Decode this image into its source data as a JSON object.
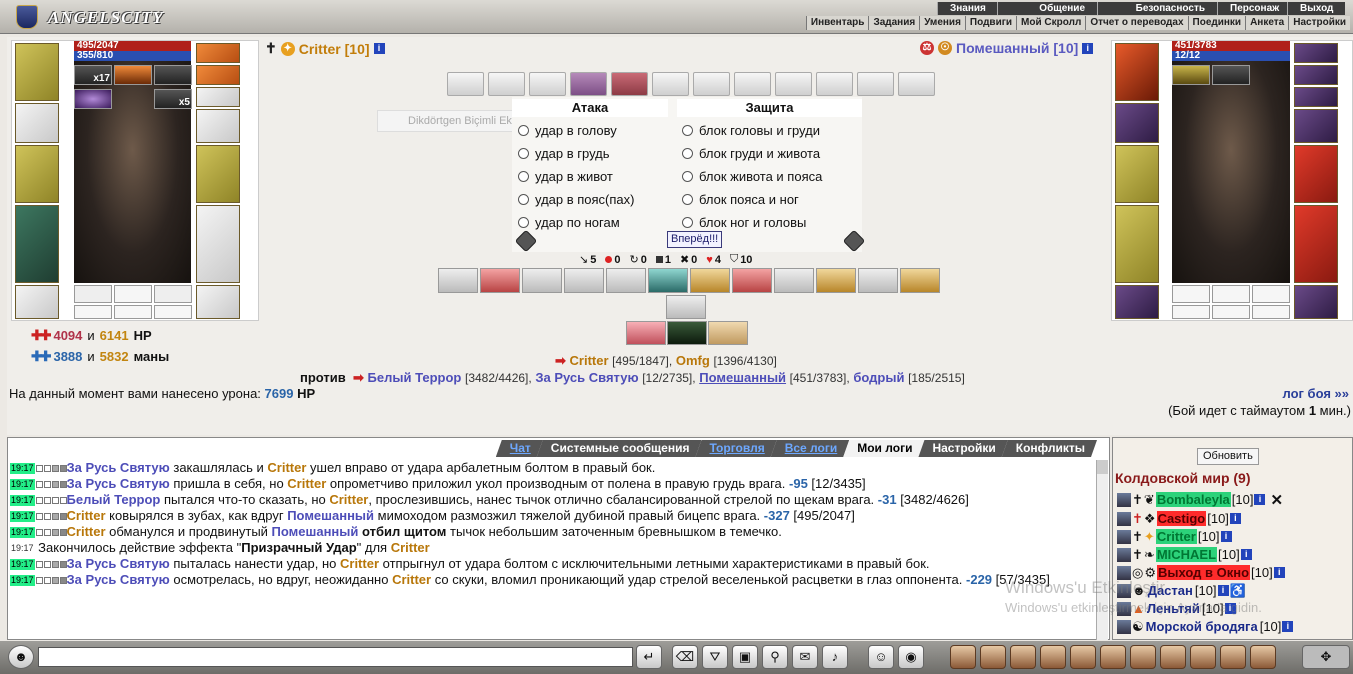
{
  "app": {
    "logo": "ANGELSCITY"
  },
  "menu_main": [
    "Знания",
    "Общение",
    "Безопасность",
    "Персонаж",
    "Выход"
  ],
  "menu_sub": [
    "Инвентарь",
    "Задания",
    "Умения",
    "Подвиги",
    "Мой Скролл",
    "Отчет о переводах",
    "Поединки",
    "Анкета",
    "Настройки"
  ],
  "left_fighter": {
    "name": "Critter [10]",
    "hp": "495/2047",
    "mana": "355/810",
    "badge1": "x17",
    "badge2": "x5"
  },
  "right_fighter": {
    "name": "Помешанный [10]",
    "hp": "451/3783",
    "mana": "12/12"
  },
  "attack": {
    "title": "Атака",
    "options": [
      "удар в голову",
      "удар в грудь",
      "удар в живот",
      "удар в пояс(пах)",
      "удар по ногам"
    ]
  },
  "defense": {
    "title": "Защита",
    "options": [
      "блок головы и груди",
      "блок груди и живота",
      "блок живота и пояса",
      "блок пояса и ног",
      "блок ног и головы"
    ]
  },
  "go_button": "Вперёд!!!",
  "ghost_text": "Dikdörtgen Biçimli Ekran Alıntısı",
  "stats": [
    "5",
    "0",
    "0",
    "1",
    "0",
    "4",
    "10"
  ],
  "hp_total": {
    "a": "4094",
    "and": "и",
    "b": "6141",
    "unit": "HP"
  },
  "mana_total": {
    "a": "3888",
    "and": "и",
    "b": "5832",
    "unit": "маны"
  },
  "battle": {
    "team1_leader": "Critter",
    "team1_leader_hp": "[495/1847]",
    "comma": ",",
    "team1_second": "Omfg",
    "team1_second_hp": "[1396/4130]",
    "vs": "против",
    "e1": "Белый Террор",
    "e1hp": "[3482/4426]",
    "e2": "За Русь Святую",
    "e2hp": "[12/2735]",
    "e3": "Помешанный",
    "e3hp": "[451/3783]",
    "e4": "бодрый",
    "e4hp": "[185/2515]",
    "damage_label": "На данный момент вами нанесено урона:",
    "damage_value": "7699",
    "damage_unit": "HP",
    "log_link": "лог боя »»",
    "timeout_a": "(Бой идет с таймаутом",
    "timeout_b": "1",
    "timeout_c": "мин.)"
  },
  "chat_tabs": [
    "Чат",
    "Системные сообщения",
    "Торговля",
    "Все логи",
    "Мои логи",
    "Настройки",
    "Конфликты"
  ],
  "log_lines": [
    {
      "t": "19:17",
      "a": "За Русь Святую",
      "b": " закашлялась и ",
      "c": "Critter",
      "d": " ушел вправо от удара арбалетным болтом в правый бок."
    },
    {
      "t": "19:17",
      "a": "За Русь Святую",
      "b": " пришла в себя, но ",
      "c": "Critter",
      "d": " опрометчиво приложил укол производным от полена в правую грудь врага. ",
      "n": "-95",
      "e": " [12/3435]"
    },
    {
      "t": "19:17",
      "a": "Белый Террор",
      "b": " пытался что-то сказать, но ",
      "c": "Critter",
      "d": ", прослезившись, нанес тычок отлично сбалансированной стрелой по щекам врага. ",
      "n": "-31",
      "e": " [3482/4626]"
    },
    {
      "t": "19:17",
      "a": "Critter",
      "b": " ковырялся в зубах, как вдруг ",
      "c": "Помешанный",
      "d": " мимоходом размозжил тяжелой дубиной правый бицепс врага. ",
      "n": "-327",
      "e": " [495/2047]"
    },
    {
      "t": "19:17",
      "a": "Critter",
      "b": " обманулся и продвинутый ",
      "c": "Помешанный",
      "d": " отбил щитом",
      "e": " тычок небольшим заточенным бревнышком в темечко."
    },
    {
      "t": "19:17",
      "a": "Закончилось действие эффекта \"",
      "b": "Призрачный Удар",
      "c": "\" для ",
      "d": "Critter"
    },
    {
      "t": "19:17",
      "a": "За Русь Святую",
      "b": " пыталась нанести удар, но ",
      "c": "Critter",
      "d": " отпрыгнул от удара болтом с исключительными летными характеристиками в правый бок."
    },
    {
      "t": "19:17",
      "a": "За Русь Святую",
      "b": " осмотрелась, но вдруг, неожиданно ",
      "c": "Critter",
      "d": " со скуки, вломил проникающий удар стрелой веселенькой расцветки в глаз оппонента. ",
      "n": "-229",
      "e": " [57/3435]"
    }
  ],
  "side": {
    "refresh": "Обновить",
    "world": "Колдовской мир (9)",
    "players": [
      {
        "name": "Bombaleyla",
        "lvl": "[10]"
      },
      {
        "name": "Castigo",
        "lvl": "[10]"
      },
      {
        "name": "Critter",
        "lvl": "[10]"
      },
      {
        "name": "MICHAEL",
        "lvl": "[10]"
      },
      {
        "name": "Выход в Окно",
        "lvl": "[10]"
      },
      {
        "name": "Дастан",
        "lvl": "[10]"
      },
      {
        "name": "Леньтяй",
        "lvl": "[10]"
      },
      {
        "name": "Морской бродяга",
        "lvl": "[10]"
      }
    ]
  },
  "watermark": {
    "line1": "Windows'u Etkinleştir",
    "line2": "Windows'u etkinleştirmek için Ayarlar'a gidin."
  }
}
